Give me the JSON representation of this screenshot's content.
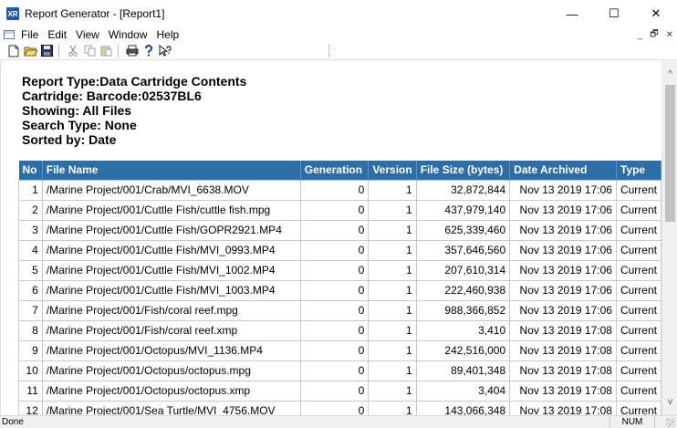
{
  "window": {
    "title": "Report Generator - [Report1]",
    "app_icon_text": "XR",
    "controls": {
      "minimize": "—",
      "maximize": "☐",
      "close": "✕"
    }
  },
  "menu": {
    "items": [
      "File",
      "Edit",
      "View",
      "Window",
      "Help"
    ],
    "mdi_controls": {
      "minimize": "_",
      "restore": "🗗",
      "close": "✕"
    }
  },
  "toolbar": {
    "buttons": [
      "new-icon",
      "open-icon",
      "save-icon",
      "cut-icon",
      "copy-icon",
      "paste-icon",
      "print-icon",
      "help-icon",
      "context-help-icon"
    ]
  },
  "report": {
    "header_lines": [
      "Report Type:Data Cartridge Contents",
      "Cartridge: Barcode:02537BL6",
      "Showing: All Files",
      "Search Type: None",
      "Sorted by: Date"
    ],
    "columns": [
      "No",
      "File Name",
      "Generation",
      "Version",
      "File Size (bytes)",
      "Date Archived",
      "Type"
    ],
    "rows": [
      [
        "1",
        "/Marine Project/001/Crab/MVI_6638.MOV",
        "0",
        "1",
        "32,872,844",
        "Nov 13 2019 17:06",
        "Current"
      ],
      [
        "2",
        "/Marine Project/001/Cuttle Fish/cuttle fish.mpg",
        "0",
        "1",
        "437,979,140",
        "Nov 13 2019 17:06",
        "Current"
      ],
      [
        "3",
        "/Marine Project/001/Cuttle Fish/GOPR2921.MP4",
        "0",
        "1",
        "625,339,460",
        "Nov 13 2019 17:06",
        "Current"
      ],
      [
        "4",
        "/Marine Project/001/Cuttle Fish/MVI_0993.MP4",
        "0",
        "1",
        "357,646,560",
        "Nov 13 2019 17:06",
        "Current"
      ],
      [
        "5",
        "/Marine Project/001/Cuttle Fish/MVI_1002.MP4",
        "0",
        "1",
        "207,610,314",
        "Nov 13 2019 17:06",
        "Current"
      ],
      [
        "6",
        "/Marine Project/001/Cuttle Fish/MVI_1003.MP4",
        "0",
        "1",
        "222,460,938",
        "Nov 13 2019 17:06",
        "Current"
      ],
      [
        "7",
        "/Marine Project/001/Fish/coral reef.mpg",
        "0",
        "1",
        "988,366,852",
        "Nov 13 2019 17:06",
        "Current"
      ],
      [
        "8",
        "/Marine Project/001/Fish/coral reef.xmp",
        "0",
        "1",
        "3,410",
        "Nov 13 2019 17:08",
        "Current"
      ],
      [
        "9",
        "/Marine Project/001/Octopus/MVI_1136.MP4",
        "0",
        "1",
        "242,516,000",
        "Nov 13 2019 17:08",
        "Current"
      ],
      [
        "10",
        "/Marine Project/001/Octopus/octopus.mpg",
        "0",
        "1",
        "89,401,348",
        "Nov 13 2019 17:08",
        "Current"
      ],
      [
        "11",
        "/Marine Project/001/Octopus/octopus.xmp",
        "0",
        "1",
        "3,404",
        "Nov 13 2019 17:08",
        "Current"
      ],
      [
        "12",
        "/Marine Project/001/Sea Turtle/MVI_4756.MOV",
        "0",
        "1",
        "143,066,348",
        "Nov 13 2019 17:08",
        "Current"
      ]
    ]
  },
  "status": {
    "text": "Done",
    "num": "NUM"
  }
}
